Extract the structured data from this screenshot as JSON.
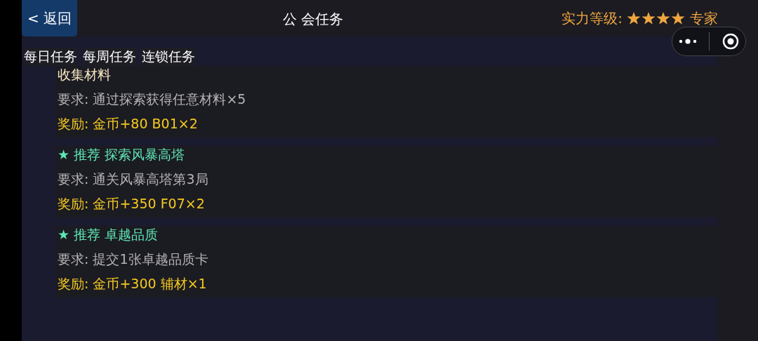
{
  "header": {
    "back_label": "< 返回",
    "title": "公 会任务",
    "rank_label": "实力等级:",
    "stars": 4,
    "rank_name": "专家"
  },
  "tabs": [
    {
      "label": "每日任务"
    },
    {
      "label": "每周任务"
    },
    {
      "label": "连锁任务"
    }
  ],
  "tasks": [
    {
      "kind": "normal",
      "title": "收集材料",
      "requirement": "要求: 通过探索获得任意材料×5",
      "reward": "奖励: 金币+80 B01×2"
    },
    {
      "kind": "recommended",
      "title": "★ 推荐 探索风暴高塔",
      "requirement": "要求: 通关风暴高塔第3局",
      "reward": "奖励: 金币+350 F07×2"
    },
    {
      "kind": "recommended",
      "title": "★ 推荐 卓越品质",
      "requirement": "要求: 提交1张卓越品质卡",
      "reward": "奖励: 金币+300 辅材×1"
    }
  ]
}
